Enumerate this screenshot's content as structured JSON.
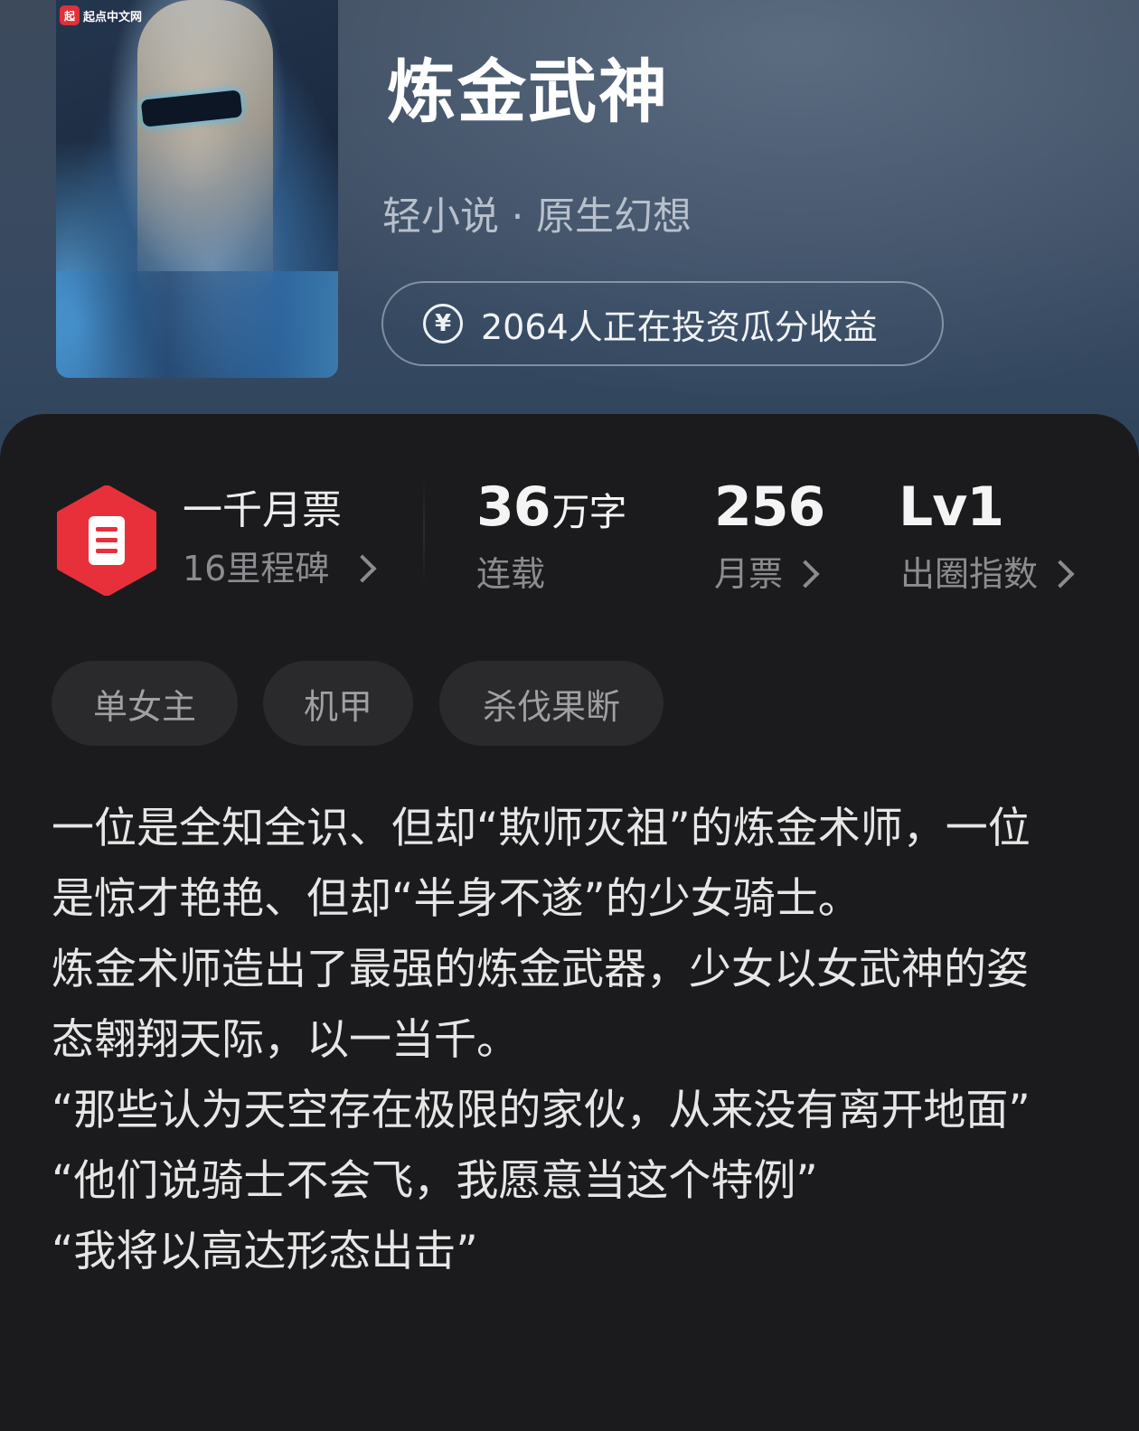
{
  "book": {
    "cover_logo_text": "起点中文网",
    "cover_logo_mark": "起",
    "title": "炼金武神",
    "category": "轻小说 · 原生幻想",
    "invest_text": "2064人正在投资瓜分收益"
  },
  "stats": {
    "milestone_title": "一千月票",
    "milestone_sub": "16里程碑",
    "words_value": "36",
    "words_unit": "万字",
    "words_label": "连载",
    "tickets_value": "256",
    "tickets_label": "月票",
    "level_value": "Lv1",
    "level_label": "出圈指数"
  },
  "tags": [
    "单女主",
    "机甲",
    "杀伐果断"
  ],
  "description": [
    "一位是全知全识、但却“欺师灭祖”的炼金术师，一位是惊才艳艳、但却“半身不遂”的少女骑士。",
    "炼金术师造出了最强的炼金武器，少女以女武神的姿态翱翔天际，以一当千。",
    "“那些认为天空存在极限的家伙，从来没有离开地面”",
    "“他们说骑士不会飞，我愿意当这个特例”",
    "“我将以高达形态出击”"
  ],
  "colors": {
    "accent_red": "#e8303b",
    "panel_bg": "#1b1b1d",
    "hero_bg": "#3a4a60"
  },
  "icons": [
    "yen-coin-icon",
    "milestone-badge-icon",
    "chevron-right-icon"
  ]
}
